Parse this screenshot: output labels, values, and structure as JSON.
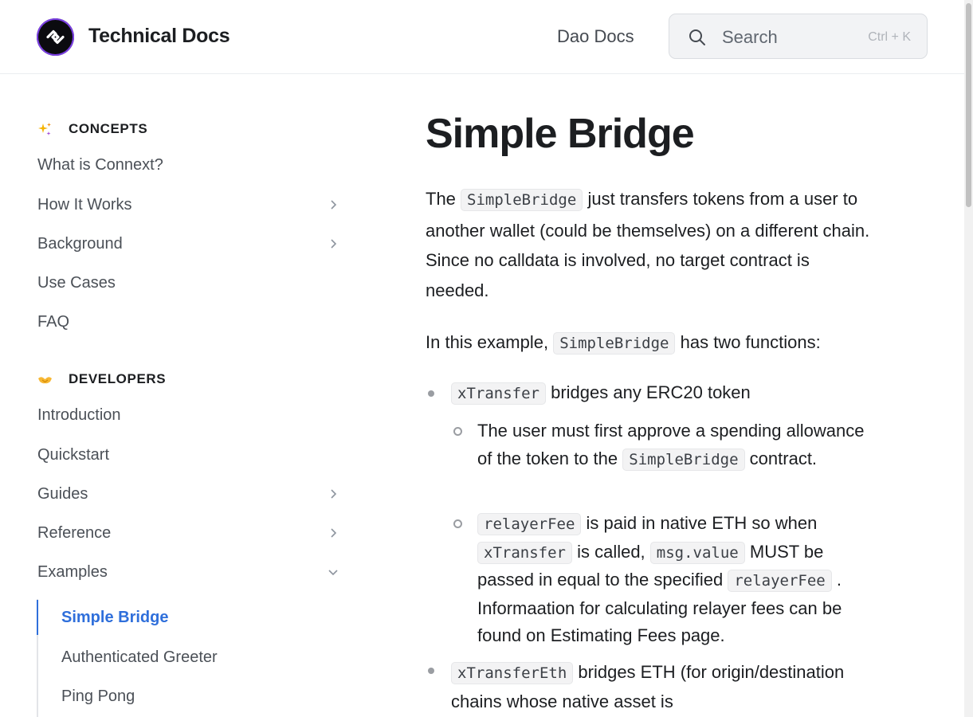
{
  "header": {
    "site_title": "Technical Docs",
    "nav_link": "Dao Docs",
    "search_placeholder": "Search",
    "search_shortcut": "Ctrl + K"
  },
  "sidebar": {
    "sections": [
      {
        "title": "CONCEPTS",
        "icon": "sparkles-icon"
      },
      {
        "title": "DEVELOPERS",
        "icon": "handshake-icon"
      }
    ],
    "concepts_items": [
      {
        "label": "What is Connext?",
        "expandable": false
      },
      {
        "label": "How It Works",
        "expandable": true
      },
      {
        "label": "Background",
        "expandable": true
      },
      {
        "label": "Use Cases",
        "expandable": false
      },
      {
        "label": "FAQ",
        "expandable": false
      }
    ],
    "developers_items": [
      {
        "label": "Introduction",
        "expandable": false
      },
      {
        "label": "Quickstart",
        "expandable": false
      },
      {
        "label": "Guides",
        "expandable": true
      },
      {
        "label": "Reference",
        "expandable": true
      },
      {
        "label": "Examples",
        "expandable": true,
        "expanded": true
      }
    ],
    "examples_children": [
      {
        "label": "Simple Bridge",
        "active": true
      },
      {
        "label": "Authenticated Greeter",
        "active": false
      },
      {
        "label": "Ping Pong",
        "active": false
      }
    ]
  },
  "content": {
    "title": "Simple Bridge",
    "intro": {
      "pre": "The",
      "code": "SimpleBridge",
      "post": "just transfers tokens from a user to another wallet (could be themselves) on a different chain. Since no calldata is involved, no target contract is needed."
    },
    "example_line": {
      "pre": "In this example,",
      "code": "SimpleBridge",
      "post": "has two functions:"
    },
    "list": {
      "item1": {
        "code": "xTransfer",
        "text": "bridges any ERC20 token"
      },
      "sub1": {
        "text": "The user must first approve a spending allowance of the token to the",
        "code": "SimpleBridge",
        "post": "contract."
      },
      "sub2": {
        "code1": "relayerFee",
        "text1": "is paid in native ETH so when",
        "code2": "xTransfer",
        "text2": "is called,",
        "code3": "msg.value",
        "text3": "MUST be passed in equal to the specified",
        "code4": "relayerFee",
        "text4": ". Informaation for calculating relayer fees can be found on Estimating Fees page."
      },
      "item2": {
        "code": "xTransferEth",
        "text": "bridges ETH (for origin/destination chains whose native asset is"
      }
    }
  },
  "colors": {
    "accent": "#2f6fdb",
    "text": "#1c1e21",
    "muted": "#4b5057"
  }
}
